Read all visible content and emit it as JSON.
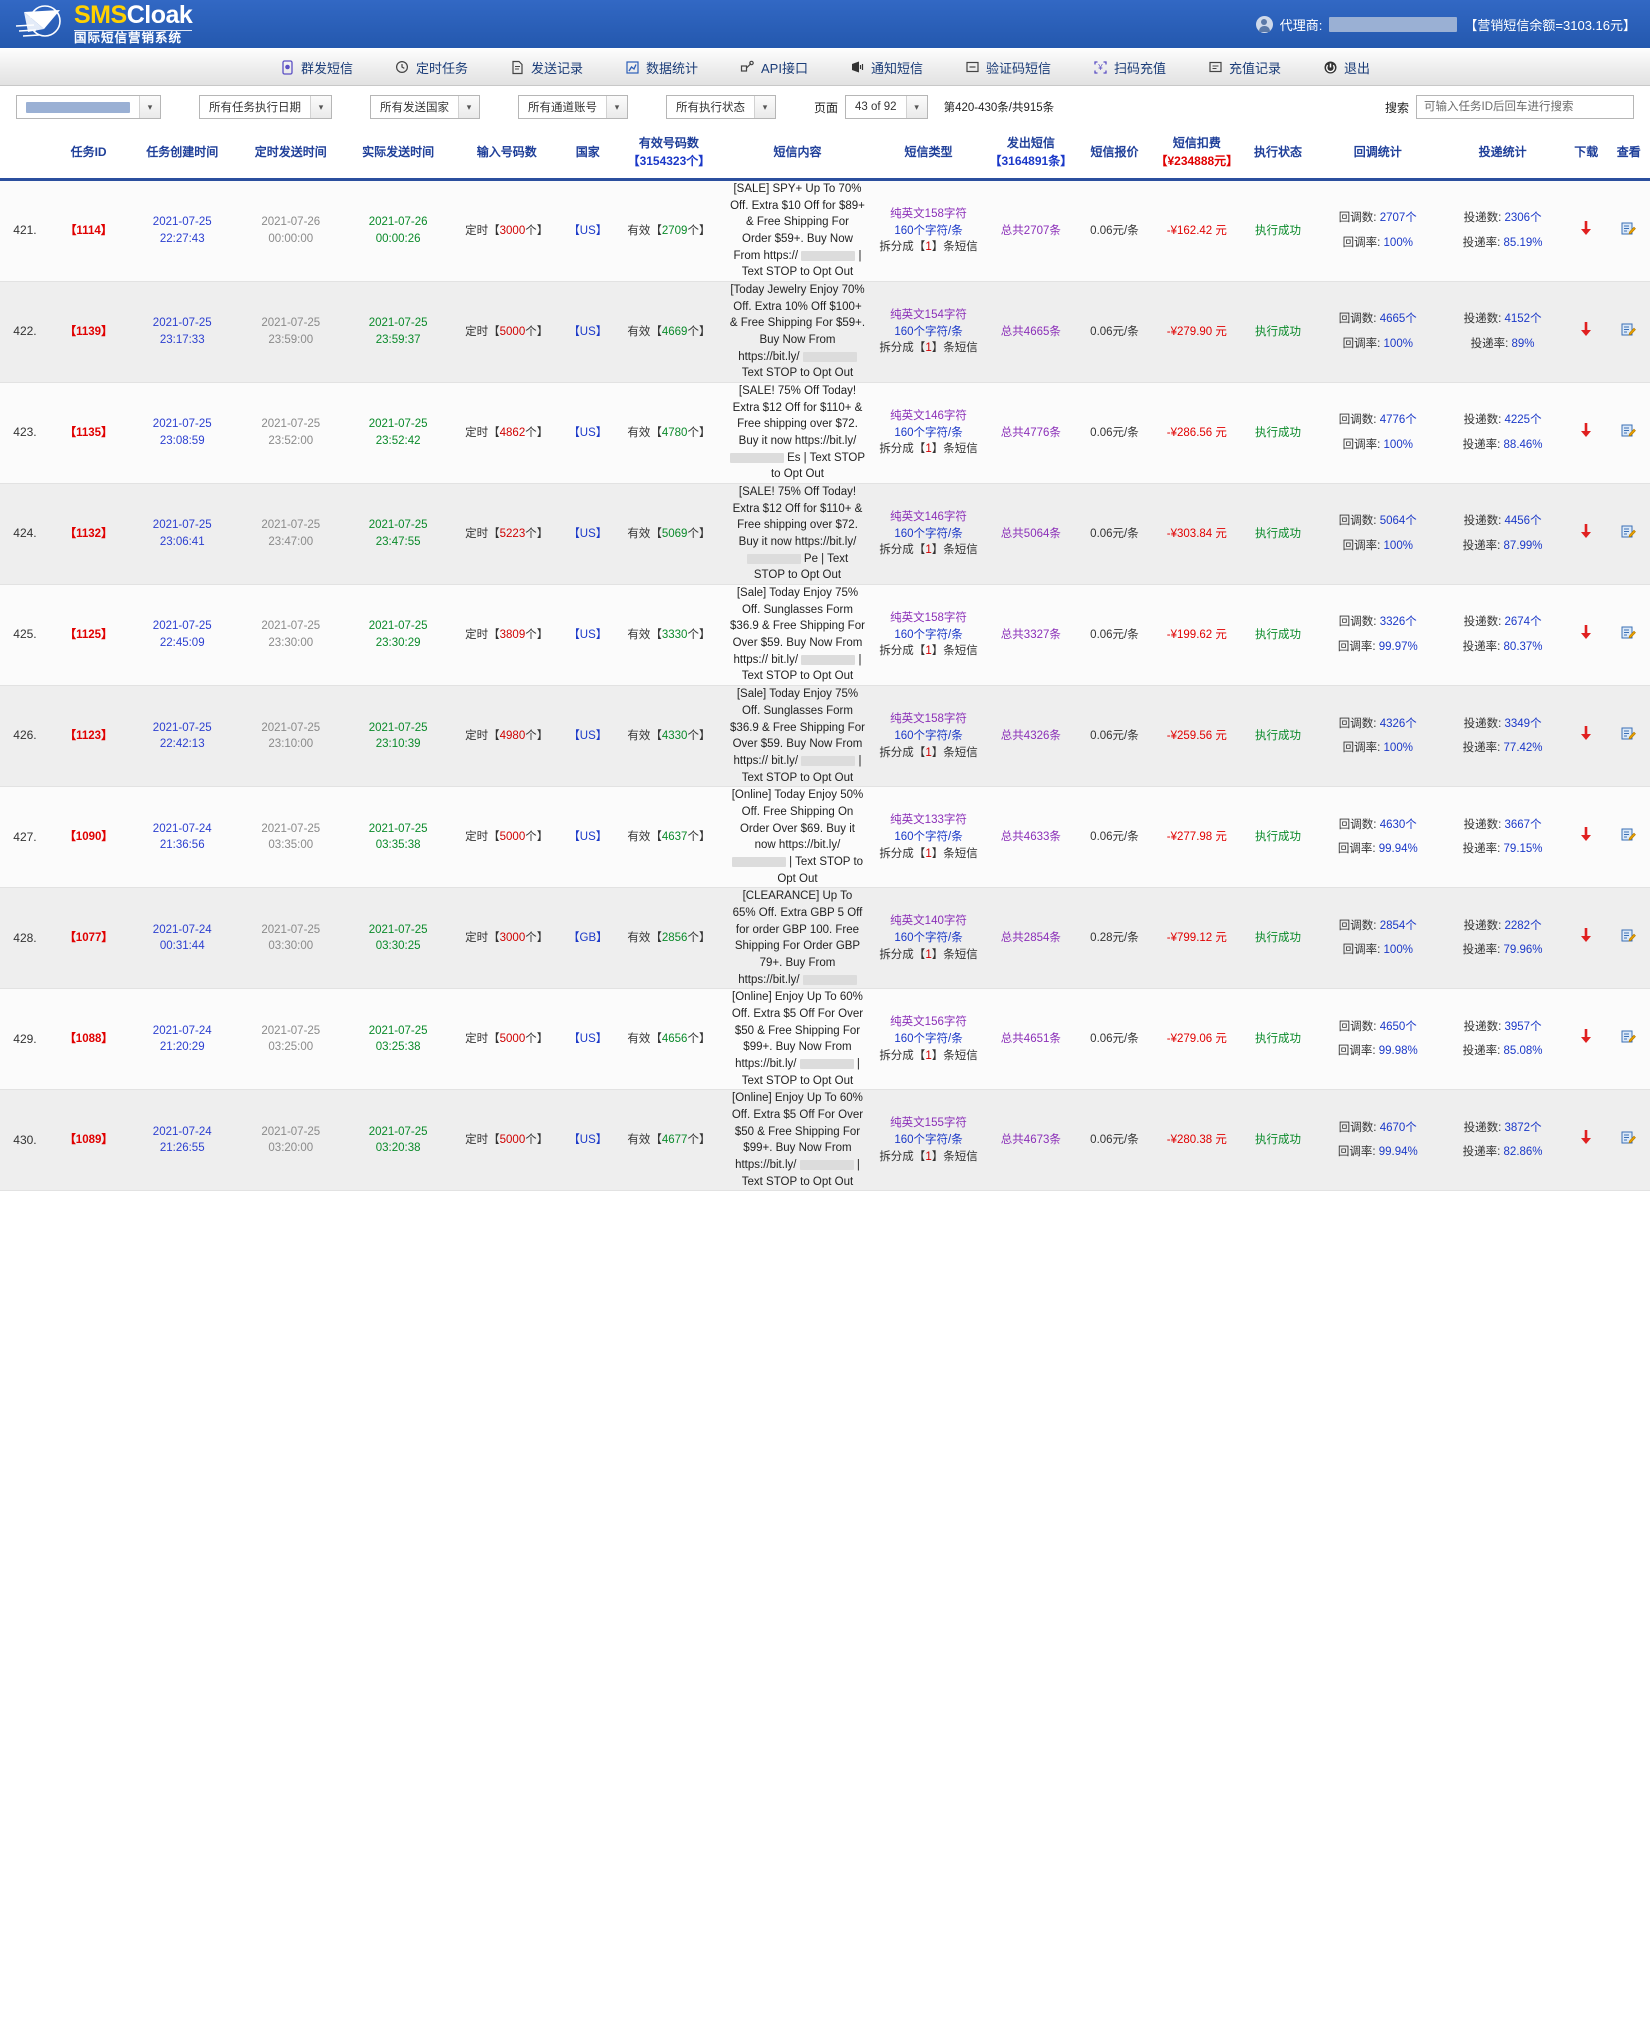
{
  "header": {
    "logo_title_a": "SMS",
    "logo_title_b": "Cloak",
    "logo_sub": "国际短信营销系统",
    "account_label": "代理商:",
    "account_value": "",
    "balance": "【营销短信余额=3103.16元】"
  },
  "nav": [
    {
      "label": "群发短信",
      "icon": "bulk-sms-icon"
    },
    {
      "label": "定时任务",
      "icon": "scheduled-task-icon"
    },
    {
      "label": "发送记录",
      "icon": "send-record-icon"
    },
    {
      "label": "数据统计",
      "icon": "statistics-icon"
    },
    {
      "label": "API接口",
      "icon": "api-icon"
    },
    {
      "label": "通知短信",
      "icon": "notify-sms-icon"
    },
    {
      "label": "验证码短信",
      "icon": "verify-sms-icon"
    },
    {
      "label": "扫码充值",
      "icon": "qr-recharge-icon"
    },
    {
      "label": "充值记录",
      "icon": "recharge-record-icon"
    },
    {
      "label": "退出",
      "icon": "logout-icon"
    }
  ],
  "filters": {
    "account_select": "",
    "date_select": "所有任务执行日期",
    "country_select": "所有发送国家",
    "channel_select": "所有通道账号",
    "status_select": "所有执行状态",
    "page_label": "页面",
    "page_select": "43 of 92",
    "range_text": "第420-430条/共915条",
    "search_label": "搜索",
    "search_placeholder": "可输入任务ID后回车进行搜索",
    "search_value": ""
  },
  "columns": [
    {
      "key": "idx",
      "label": ""
    },
    {
      "key": "task_id",
      "label": "任务ID"
    },
    {
      "key": "created",
      "label": "任务创建时间"
    },
    {
      "key": "planned",
      "label": "定时发送时间"
    },
    {
      "key": "actual",
      "label": "实际发送时间"
    },
    {
      "key": "input_count",
      "label": "输入号码数"
    },
    {
      "key": "country",
      "label": "国家"
    },
    {
      "key": "valid_count",
      "label": "有效号码数",
      "sub": "【3154323个】",
      "sub_color": "blue"
    },
    {
      "key": "content",
      "label": "短信内容"
    },
    {
      "key": "sms_type",
      "label": "短信类型"
    },
    {
      "key": "sent",
      "label": "发出短信",
      "sub": "【3164891条】",
      "sub_color": "blue"
    },
    {
      "key": "price",
      "label": "短信报价"
    },
    {
      "key": "fee",
      "label": "短信扣费",
      "sub": "【¥234888元】",
      "sub_color": "red"
    },
    {
      "key": "status",
      "label": "执行状态"
    },
    {
      "key": "callback",
      "label": "回调统计"
    },
    {
      "key": "delivery",
      "label": "投递统计"
    },
    {
      "key": "download",
      "label": "下载"
    },
    {
      "key": "view",
      "label": "查看"
    }
  ],
  "rows": [
    {
      "idx": "421.",
      "task_id": "【1114】",
      "created": "2021-07-25 22:27:43",
      "planned": "2021-07-26 00:00:00",
      "actual": "2021-07-26 00:00:26",
      "input_prefix": "定时【",
      "input_num": "3000",
      "input_suffix": "个】",
      "country": "【US】",
      "valid_prefix": "有效【",
      "valid_num": "2709",
      "valid_suffix": "个】",
      "content": "SALE] SPY+ Up To 70% Off. Extra $10 Off for $89+ & Free Shipping For Order $59+. Buy Now From https:// ▮ | Text STOP to Opt Out",
      "type_a": "纯英文158字符",
      "type_b": "160个字符/条",
      "type_c_pre": "拆分成【",
      "type_c_num": "1",
      "type_c_post": "】条短信",
      "sent": "总共2707条",
      "price": "0.06元/条",
      "fee": "-¥162.42 元",
      "status": "执行成功",
      "cb_label": "回调数:",
      "cb_value": "2707个",
      "cbr_label": "回调率:",
      "cbr_value": "100%",
      "dv_label": "投递数:",
      "dv_value": "2306个",
      "dvr_label": "投递率:",
      "dvr_value": "85.19%"
    },
    {
      "idx": "422.",
      "task_id": "【1139】",
      "created": "2021-07-25 23:17:33",
      "planned": "2021-07-25 23:59:00",
      "actual": "2021-07-25 23:59:37",
      "input_prefix": "定时【",
      "input_num": "5000",
      "input_suffix": "个】",
      "country": "【US】",
      "valid_prefix": "有效【",
      "valid_num": "4669",
      "valid_suffix": "个】",
      "content": "Today Jewelry Enjoy 70% Off. Extra 10% Off $100+ & Free Shipping For $59+. Buy Now From https://bit.ly/ ▮ Text STOP to Opt Out",
      "type_a": "纯英文154字符",
      "type_b": "160个字符/条",
      "type_c_pre": "拆分成【",
      "type_c_num": "1",
      "type_c_post": "】条短信",
      "sent": "总共4665条",
      "price": "0.06元/条",
      "fee": "-¥279.90 元",
      "status": "执行成功",
      "cb_label": "回调数:",
      "cb_value": "4665个",
      "cbr_label": "回调率:",
      "cbr_value": "100%",
      "dv_label": "投递数:",
      "dv_value": "4152个",
      "dvr_label": "投递率:",
      "dvr_value": "89%"
    },
    {
      "idx": "423.",
      "task_id": "【1135】",
      "created": "2021-07-25 23:08:59",
      "planned": "2021-07-25 23:52:00",
      "actual": "2021-07-25 23:52:42",
      "input_prefix": "定时【",
      "input_num": "4862",
      "input_suffix": "个】",
      "country": "【US】",
      "valid_prefix": "有效【",
      "valid_num": "4780",
      "valid_suffix": "个】",
      "content": "SALE! 75% Off Today! Extra $12 Off for $110+ & Free shipping over $72. Buy it now https://bit.ly/ ▮ Es | Text STOP to Opt Out",
      "type_a": "纯英文146字符",
      "type_b": "160个字符/条",
      "type_c_pre": "拆分成【",
      "type_c_num": "1",
      "type_c_post": "】条短信",
      "sent": "总共4776条",
      "price": "0.06元/条",
      "fee": "-¥286.56 元",
      "status": "执行成功",
      "cb_label": "回调数:",
      "cb_value": "4776个",
      "cbr_label": "回调率:",
      "cbr_value": "100%",
      "dv_label": "投递数:",
      "dv_value": "4225个",
      "dvr_label": "投递率:",
      "dvr_value": "88.46%"
    },
    {
      "idx": "424.",
      "task_id": "【1132】",
      "created": "2021-07-25 23:06:41",
      "planned": "2021-07-25 23:47:00",
      "actual": "2021-07-25 23:47:55",
      "input_prefix": "定时【",
      "input_num": "5223",
      "input_suffix": "个】",
      "country": "【US】",
      "valid_prefix": "有效【",
      "valid_num": "5069",
      "valid_suffix": "个】",
      "content": "SALE! 75% Off Today! Extra $12 Off for $110+ & Free shipping over $72. Buy it now https://bit.ly/ ▮ Pe | Text STOP to Opt Out",
      "type_a": "纯英文146字符",
      "type_b": "160个字符/条",
      "type_c_pre": "拆分成【",
      "type_c_num": "1",
      "type_c_post": "】条短信",
      "sent": "总共5064条",
      "price": "0.06元/条",
      "fee": "-¥303.84 元",
      "status": "执行成功",
      "cb_label": "回调数:",
      "cb_value": "5064个",
      "cbr_label": "回调率:",
      "cbr_value": "100%",
      "dv_label": "投递数:",
      "dv_value": "4456个",
      "dvr_label": "投递率:",
      "dvr_value": "87.99%"
    },
    {
      "idx": "425.",
      "task_id": "【1125】",
      "created": "2021-07-25 22:45:09",
      "planned": "2021-07-25 23:30:00",
      "actual": "2021-07-25 23:30:29",
      "input_prefix": "定时【",
      "input_num": "3809",
      "input_suffix": "个】",
      "country": "【US】",
      "valid_prefix": "有效【",
      "valid_num": "3330",
      "valid_suffix": "个】",
      "content": "Sale] Today Enjoy 75% Off. Sunglasses Form $36.9 & Free Shipping For Over $59. Buy Now From https:// bit.ly/ ▮ | Text STOP to Opt Out",
      "type_a": "纯英文158字符",
      "type_b": "160个字符/条",
      "type_c_pre": "拆分成【",
      "type_c_num": "1",
      "type_c_post": "】条短信",
      "sent": "总共3327条",
      "price": "0.06元/条",
      "fee": "-¥199.62 元",
      "status": "执行成功",
      "cb_label": "回调数:",
      "cb_value": "3326个",
      "cbr_label": "回调率:",
      "cbr_value": "99.97%",
      "dv_label": "投递数:",
      "dv_value": "2674个",
      "dvr_label": "投递率:",
      "dvr_value": "80.37%"
    },
    {
      "idx": "426.",
      "task_id": "【1123】",
      "created": "2021-07-25 22:42:13",
      "planned": "2021-07-25 23:10:00",
      "actual": "2021-07-25 23:10:39",
      "input_prefix": "定时【",
      "input_num": "4980",
      "input_suffix": "个】",
      "country": "【US】",
      "valid_prefix": "有效【",
      "valid_num": "4330",
      "valid_suffix": "个】",
      "content": "Sale] Today Enjoy 75% Off. Sunglasses Form $36.9 & Free Shipping For Over $59. Buy Now From https:// bit.ly/ ▮ | Text STOP to Opt Out",
      "type_a": "纯英文158字符",
      "type_b": "160个字符/条",
      "type_c_pre": "拆分成【",
      "type_c_num": "1",
      "type_c_post": "】条短信",
      "sent": "总共4326条",
      "price": "0.06元/条",
      "fee": "-¥259.56 元",
      "status": "执行成功",
      "cb_label": "回调数:",
      "cb_value": "4326个",
      "cbr_label": "回调率:",
      "cbr_value": "100%",
      "dv_label": "投递数:",
      "dv_value": "3349个",
      "dvr_label": "投递率:",
      "dvr_value": "77.42%"
    },
    {
      "idx": "427.",
      "task_id": "【1090】",
      "created": "2021-07-24 21:36:56",
      "planned": "2021-07-25 03:35:00",
      "actual": "2021-07-25 03:35:38",
      "input_prefix": "定时【",
      "input_num": "5000",
      "input_suffix": "个】",
      "country": "【US】",
      "valid_prefix": "有效【",
      "valid_num": "4637",
      "valid_suffix": "个】",
      "content": "Online] Today Enjoy 50% Off. Free Shipping On Order Over $69. Buy it now https://bit.ly/ ▮ | Text STOP to Opt Out",
      "type_a": "纯英文133字符",
      "type_b": "160个字符/条",
      "type_c_pre": "拆分成【",
      "type_c_num": "1",
      "type_c_post": "】条短信",
      "sent": "总共4633条",
      "price": "0.06元/条",
      "fee": "-¥277.98 元",
      "status": "执行成功",
      "cb_label": "回调数:",
      "cb_value": "4630个",
      "cbr_label": "回调率:",
      "cbr_value": "99.94%",
      "dv_label": "投递数:",
      "dv_value": "3667个",
      "dvr_label": "投递率:",
      "dvr_value": "79.15%"
    },
    {
      "idx": "428.",
      "task_id": "【1077】",
      "created": "2021-07-24 00:31:44",
      "planned": "2021-07-25 03:30:00",
      "actual": "2021-07-25 03:30:25",
      "input_prefix": "定时【",
      "input_num": "3000",
      "input_suffix": "个】",
      "country": "【GB】",
      "valid_prefix": "有效【",
      "valid_num": "2856",
      "valid_suffix": "个】",
      "content": "CLEARANCE] Up To 65% Off. Extra GBP 5 Off for order GBP 100. Free Shipping For Order GBP 79+. Buy From https://bit.ly/ ▮",
      "type_a": "纯英文140字符",
      "type_b": "160个字符/条",
      "type_c_pre": "拆分成【",
      "type_c_num": "1",
      "type_c_post": "】条短信",
      "sent": "总共2854条",
      "price": "0.28元/条",
      "fee": "-¥799.12 元",
      "status": "执行成功",
      "cb_label": "回调数:",
      "cb_value": "2854个",
      "cbr_label": "回调率:",
      "cbr_value": "100%",
      "dv_label": "投递数:",
      "dv_value": "2282个",
      "dvr_label": "投递率:",
      "dvr_value": "79.96%"
    },
    {
      "idx": "429.",
      "task_id": "【1088】",
      "created": "2021-07-24 21:20:29",
      "planned": "2021-07-25 03:25:00",
      "actual": "2021-07-25 03:25:38",
      "input_prefix": "定时【",
      "input_num": "5000",
      "input_suffix": "个】",
      "country": "【US】",
      "valid_prefix": "有效【",
      "valid_num": "4656",
      "valid_suffix": "个】",
      "content": "Online] Enjoy Up To 60% Off. Extra $5 Off For Over $50 & Free Shipping For $99+. Buy Now From https://bit.ly/ ▮ | Text STOP to Opt Out",
      "type_a": "纯英文156字符",
      "type_b": "160个字符/条",
      "type_c_pre": "拆分成【",
      "type_c_num": "1",
      "type_c_post": "】条短信",
      "sent": "总共4651条",
      "price": "0.06元/条",
      "fee": "-¥279.06 元",
      "status": "执行成功",
      "cb_label": "回调数:",
      "cb_value": "4650个",
      "cbr_label": "回调率:",
      "cbr_value": "99.98%",
      "dv_label": "投递数:",
      "dv_value": "3957个",
      "dvr_label": "投递率:",
      "dvr_value": "85.08%"
    },
    {
      "idx": "430.",
      "task_id": "【1089】",
      "created": "2021-07-24 21:26:55",
      "planned": "2021-07-25 03:20:00",
      "actual": "2021-07-25 03:20:38",
      "input_prefix": "定时【",
      "input_num": "5000",
      "input_suffix": "个】",
      "country": "【US】",
      "valid_prefix": "有效【",
      "valid_num": "4677",
      "valid_suffix": "个】",
      "content": "Online] Enjoy Up To 60% Off. Extra $5 Off For Over $50 & Free Shipping For $99+. Buy Now From https://bit.ly/ ▮ | Text STOP to Opt Out",
      "type_a": "纯英文155字符",
      "type_b": "160个字符/条",
      "type_c_pre": "拆分成【",
      "type_c_num": "1",
      "type_c_post": "】条短信",
      "sent": "总共4673条",
      "price": "0.06元/条",
      "fee": "-¥280.38 元",
      "status": "执行成功",
      "cb_label": "回调数:",
      "cb_value": "4670个",
      "cbr_label": "回调率:",
      "cbr_value": "99.94%",
      "dv_label": "投递数:",
      "dv_value": "3872个",
      "dvr_label": "投递率:",
      "dvr_value": "82.86%"
    }
  ],
  "icons": {
    "download": "download-icon",
    "view": "view-edit-icon"
  }
}
